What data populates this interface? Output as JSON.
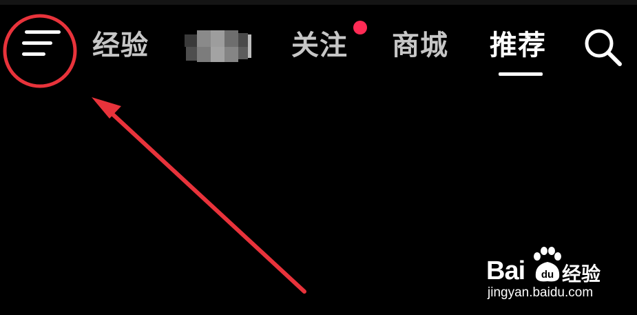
{
  "top_nav": {
    "tabs": [
      {
        "label": "经验",
        "state": "inactive"
      },
      {
        "label": "",
        "state": "inactive",
        "obscured": true
      },
      {
        "label": "关注",
        "state": "inactive",
        "notification_dot": true
      },
      {
        "label": "商城",
        "state": "inactive"
      },
      {
        "label": "推荐",
        "state": "active"
      }
    ],
    "menu_icon": "hamburger-menu-icon",
    "search_icon": "search-icon"
  },
  "annotation": {
    "highlight_color": "#e8333b",
    "target": "menu-button"
  },
  "watermark": {
    "brand": "Bai",
    "brand_paw": "du",
    "product": "经验",
    "url": "jingyan.baidu.com"
  },
  "colors": {
    "background": "#000000",
    "active_tab": "#ffffff",
    "inactive_tab": "#c6c6c6",
    "notification_dot": "#ff2b55"
  }
}
